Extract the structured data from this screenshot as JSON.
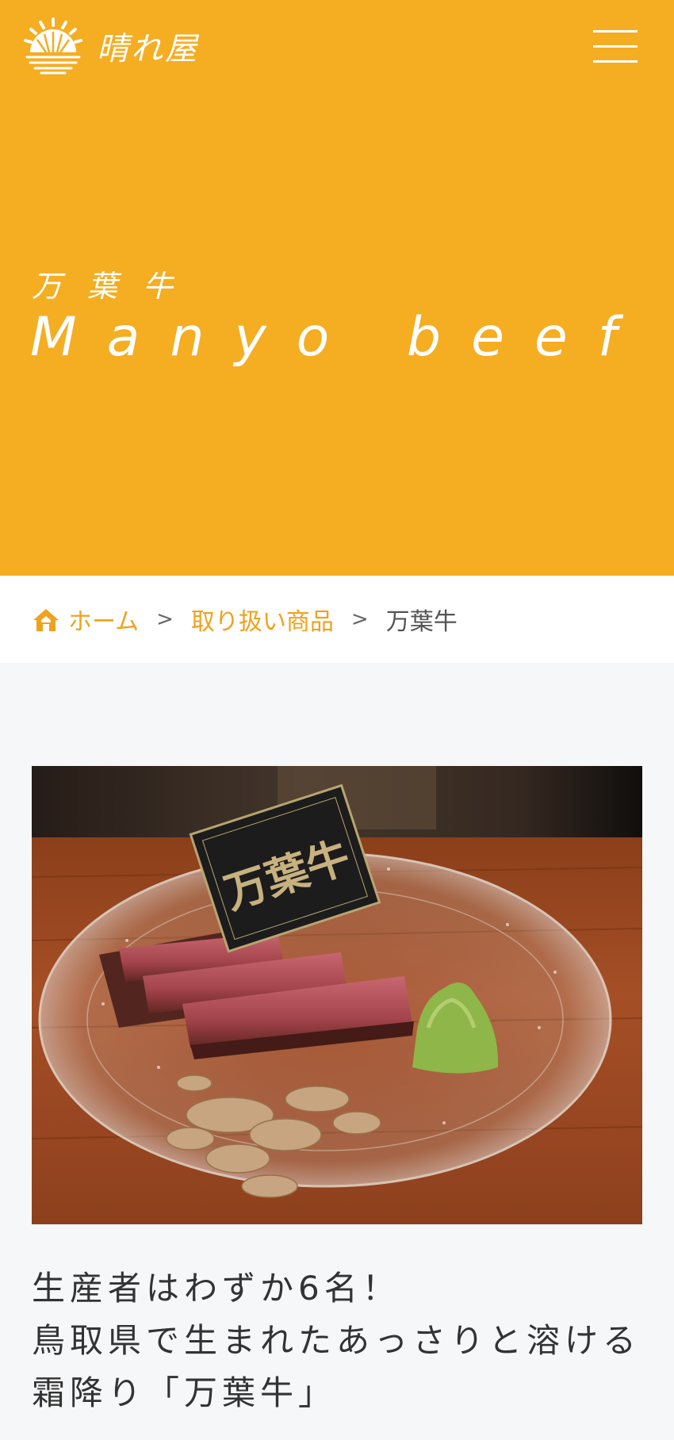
{
  "header": {
    "logo_text": "晴れ屋",
    "brand_color": "#f5ad22",
    "menu_icon": "hamburger-icon"
  },
  "hero": {
    "title_jp": "万葉牛",
    "title_en": "Manyo beef"
  },
  "breadcrumb": {
    "home_icon": "home-icon",
    "home": "ホーム",
    "separator": ">",
    "category": "取り扱い商品",
    "current": "万葉牛"
  },
  "photo": {
    "card_text": "万葉牛"
  },
  "intro": {
    "line1": "生産者はわずか6名！",
    "line2": "鳥取県で生まれたあっさりと溶ける",
    "line3": "霜降り「万葉牛」"
  }
}
